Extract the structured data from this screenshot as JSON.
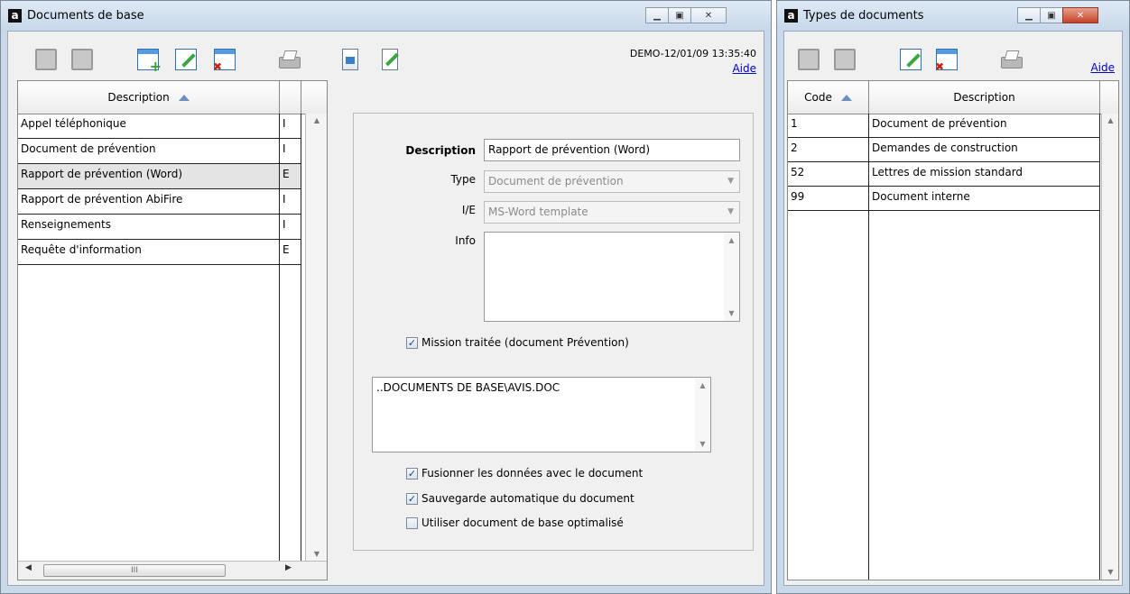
{
  "win1": {
    "title": "Documents de base",
    "status": "DEMO-12/01/09 13:35:40",
    "help": "Aide",
    "grid": {
      "header": "Description",
      "rows": [
        {
          "desc": "Appel téléphonique",
          "flag": "I"
        },
        {
          "desc": "Document de prévention",
          "flag": "I"
        },
        {
          "desc": "Rapport de prévention (Word)",
          "flag": "E"
        },
        {
          "desc": "Rapport de prévention AbiFire",
          "flag": "I"
        },
        {
          "desc": "Renseignements",
          "flag": "I"
        },
        {
          "desc": "Requête d'information",
          "flag": "E"
        }
      ]
    },
    "hscroll_thumb": "III",
    "form": {
      "description_label": "Description",
      "description_value": "Rapport de prévention (Word)",
      "type_label": "Type",
      "type_value": "Document de prévention",
      "ie_label": "I/E",
      "ie_value": "MS-Word template",
      "info_label": "Info",
      "info_value": "",
      "mission_label": "Mission traitée (document Prévention)",
      "path_value": "..DOCUMENTS DE BASE\\AVIS.DOC",
      "merge_label": "Fusionner les données avec le document",
      "autosave_label": "Sauvegarde automatique du document",
      "optimized_label": "Utiliser document de base optimalisé"
    },
    "checks": {
      "mission": "✓",
      "merge": "✓",
      "autosave": "✓",
      "optimized": ""
    }
  },
  "win2": {
    "title": "Types de documents",
    "help": "Aide",
    "grid": {
      "header_code": "Code",
      "header_desc": "Description",
      "rows": [
        {
          "code": "1",
          "desc": "Document de prévention"
        },
        {
          "code": "2",
          "desc": "Demandes de construction"
        },
        {
          "code": "52",
          "desc": "Lettres de mission standard"
        },
        {
          "code": "99",
          "desc": "Document interne"
        }
      ]
    }
  },
  "colors": {
    "title_bg": "#c9d9ea",
    "close_red": "#c7402a",
    "link": "#0000cc"
  }
}
